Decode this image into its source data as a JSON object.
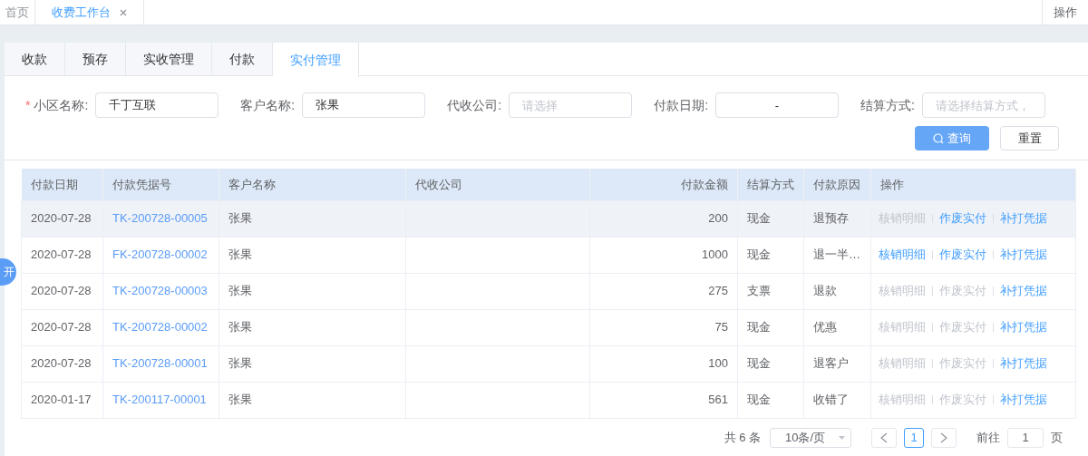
{
  "top_tabs": [
    {
      "label": "首页",
      "selected": false,
      "closable": false
    },
    {
      "label": "收费工作台",
      "selected": true,
      "closable": true
    }
  ],
  "top_action": "操作",
  "tabs": [
    {
      "label": "收款",
      "selected": false
    },
    {
      "label": "预存",
      "selected": false
    },
    {
      "label": "实收管理",
      "selected": false
    },
    {
      "label": "付款",
      "selected": false
    },
    {
      "label": "实付管理",
      "selected": true
    }
  ],
  "filters": [
    {
      "label": "小区名称:",
      "required_mark": "*",
      "value": "千丁互联"
    },
    {
      "label": "客户名称:",
      "value": "张果"
    },
    {
      "label": "代收公司:",
      "placeholder": "请选择"
    },
    {
      "label": "付款日期:",
      "value": "-",
      "kind": "range"
    },
    {
      "label": "结算方式:",
      "placeholder": "请选择结算方式，"
    }
  ],
  "buttons": [
    {
      "label": "查询",
      "kind": "primary"
    },
    {
      "label": "重置",
      "kind": "default"
    }
  ],
  "side_toggle": "开",
  "table": {
    "columns": [
      "付款日期",
      "付款凭据号",
      "客户名称",
      "代收公司",
      "付款金额",
      "结算方式",
      "付款原因",
      "操作"
    ],
    "rows": [
      {
        "highlighted": true,
        "date": "2020-07-28",
        "voucher": "TK-200728-00005",
        "customer": "张果",
        "amount": "200",
        "method": "现金",
        "reason": "退预存",
        "actions": [
          {
            "label": "核销明细",
            "disabled": true
          },
          {
            "label": "作废实付",
            "disabled": false
          },
          {
            "label": "补打凭据",
            "disabled": false
          }
        ]
      },
      {
        "highlighted": false,
        "date": "2020-07-28",
        "voucher": "FK-200728-00002",
        "customer": "张果",
        "amount": "1000",
        "method": "现金",
        "reason": "退一半…",
        "actions": [
          {
            "label": "核销明细",
            "disabled": false
          },
          {
            "label": "作废实付",
            "disabled": false
          },
          {
            "label": "补打凭据",
            "disabled": false
          }
        ]
      },
      {
        "highlighted": false,
        "date": "2020-07-28",
        "voucher": "TK-200728-00003",
        "customer": "张果",
        "amount": "275",
        "method": "支票",
        "reason": "退款",
        "actions": [
          {
            "label": "核销明细",
            "disabled": true
          },
          {
            "label": "作废实付",
            "disabled": true
          },
          {
            "label": "补打凭据",
            "disabled": false
          }
        ]
      },
      {
        "highlighted": false,
        "date": "2020-07-28",
        "voucher": "TK-200728-00002",
        "customer": "张果",
        "amount": "75",
        "method": "现金",
        "reason": "优惠",
        "actions": [
          {
            "label": "核销明细",
            "disabled": true
          },
          {
            "label": "作废实付",
            "disabled": true
          },
          {
            "label": "补打凭据",
            "disabled": false
          }
        ]
      },
      {
        "highlighted": false,
        "date": "2020-07-28",
        "voucher": "TK-200728-00001",
        "customer": "张果",
        "amount": "100",
        "method": "现金",
        "reason": "退客户",
        "actions": [
          {
            "label": "核销明细",
            "disabled": true
          },
          {
            "label": "作废实付",
            "disabled": true
          },
          {
            "label": "补打凭据",
            "disabled": false
          }
        ]
      },
      {
        "highlighted": false,
        "date": "2020-01-17",
        "voucher": "TK-200117-00001",
        "customer": "张果",
        "amount": "561",
        "method": "现金",
        "reason": "收错了",
        "actions": [
          {
            "label": "核销明细",
            "disabled": true
          },
          {
            "label": "作废实付",
            "disabled": true
          },
          {
            "label": "补打凭据",
            "disabled": false
          }
        ]
      }
    ]
  },
  "pagination": {
    "total": "共 6 条",
    "page_size": "10条/页",
    "pages": [
      {
        "label": "1",
        "selected": true
      }
    ],
    "goto_label": "前往",
    "goto_value": "1",
    "goto_suffix": "页"
  }
}
